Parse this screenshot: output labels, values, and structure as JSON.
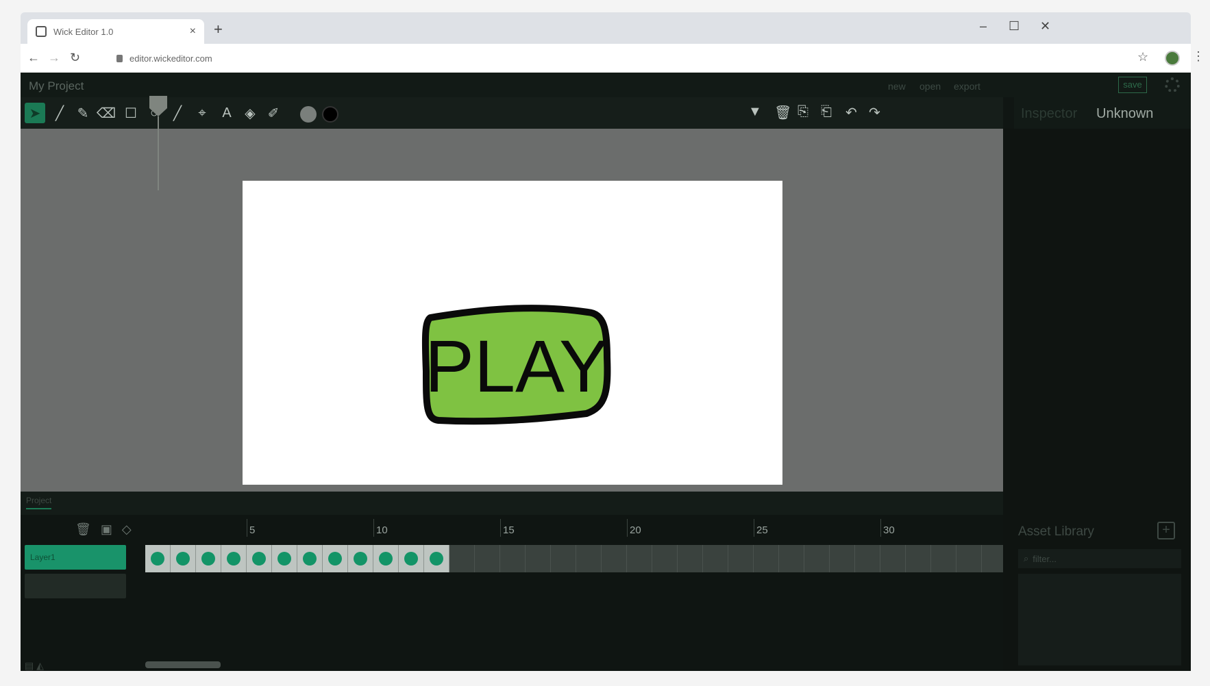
{
  "browser": {
    "tab_title": "Wick Editor 1.0",
    "tab_close": "×",
    "new_tab": "+",
    "url": "editor.wickeditor.com",
    "window_controls": {
      "minimize": "–",
      "maximize": "☐",
      "close": "✕"
    }
  },
  "editor": {
    "project_name": "My Project",
    "menu": {
      "new": "new",
      "open": "open",
      "export": "export",
      "save": "save"
    },
    "inspector": {
      "label": "Inspector",
      "value": "Unknown"
    },
    "tools": [
      "cursor-icon",
      "brush-icon",
      "pencil-icon",
      "eraser-icon",
      "rectangle-icon",
      "ellipse-icon",
      "line-icon",
      "pathcursor-icon",
      "text-icon",
      "fillbucket-icon",
      "eyedropper-icon"
    ],
    "fill_color": "#7a7f7c",
    "stroke_color": "#000000",
    "canvas_text": "PLAY",
    "button_fill": "#7fc242"
  },
  "timeline": {
    "tab": "Project",
    "layer_name": "Layer1",
    "numbers": [
      "5",
      "10",
      "15",
      "20",
      "25",
      "30"
    ],
    "keyframe_count": 12
  },
  "asset_library": {
    "title": "Asset Library",
    "filter_placeholder": "filter..."
  }
}
